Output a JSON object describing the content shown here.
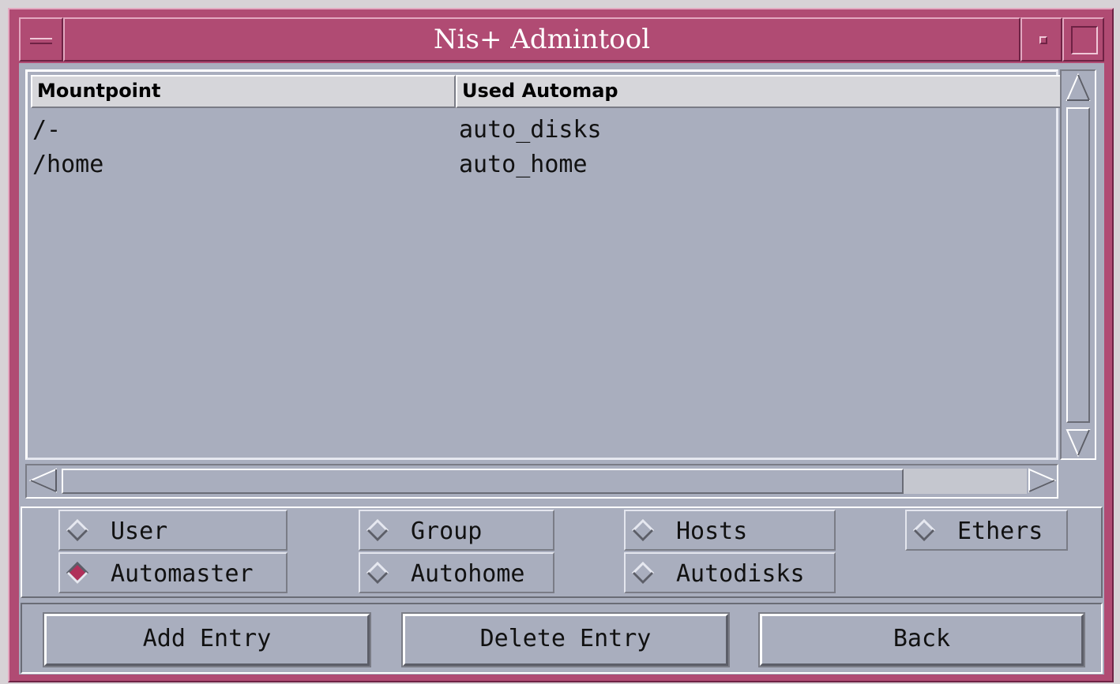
{
  "window": {
    "title": "Nis+ Admintool"
  },
  "table": {
    "columns": [
      "Mountpoint",
      "Used Automap"
    ],
    "rows": [
      [
        "/-",
        "auto_disks"
      ],
      [
        "/home",
        "auto_home"
      ]
    ]
  },
  "radios": {
    "user": "User",
    "group": "Group",
    "hosts": "Hosts",
    "ethers": "Ethers",
    "automaster": "Automaster",
    "autohome": "Autohome",
    "autodisks": "Autodisks",
    "selected": "Automaster"
  },
  "buttons": {
    "add": "Add Entry",
    "delete": "Delete Entry",
    "back": "Back"
  },
  "colors": {
    "frame": "#b04b73",
    "panel": "#a9aebe",
    "radio_selected": "#b0305a"
  }
}
